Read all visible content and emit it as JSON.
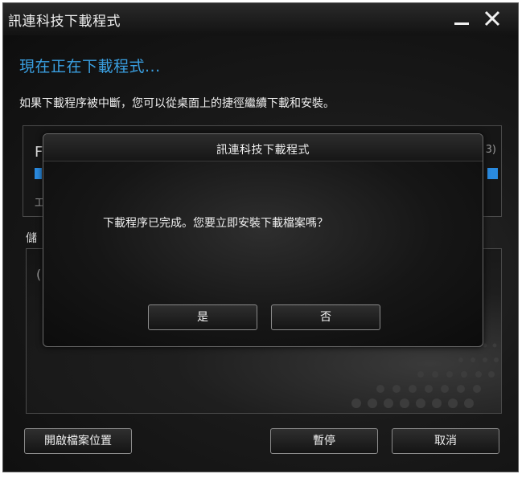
{
  "window": {
    "title": "訊連科技下載程式"
  },
  "main": {
    "heading": "現在正在下載程式...",
    "description": "如果下載程序被中斷，您可以從桌面上的捷徑繼續下載和安裝。",
    "progress_fragment_left": "F",
    "progress_fragment_right": "3)",
    "status_fragment": "工",
    "storage_fragment": "儲",
    "list_fragment": "("
  },
  "buttons": {
    "open_location": "開啟檔案位置",
    "pause": "暫停",
    "cancel": "取消"
  },
  "dialog": {
    "title": "訊連科技下載程式",
    "message": "下載程序已完成。您要立即安裝下載檔案嗎？",
    "yes": "是",
    "no": "否"
  },
  "icons": {
    "minimize": "minimize-icon",
    "close": "close-icon"
  },
  "colors": {
    "accent": "#3aa0e2",
    "progress": "#2a8be0",
    "background": "#161616"
  }
}
